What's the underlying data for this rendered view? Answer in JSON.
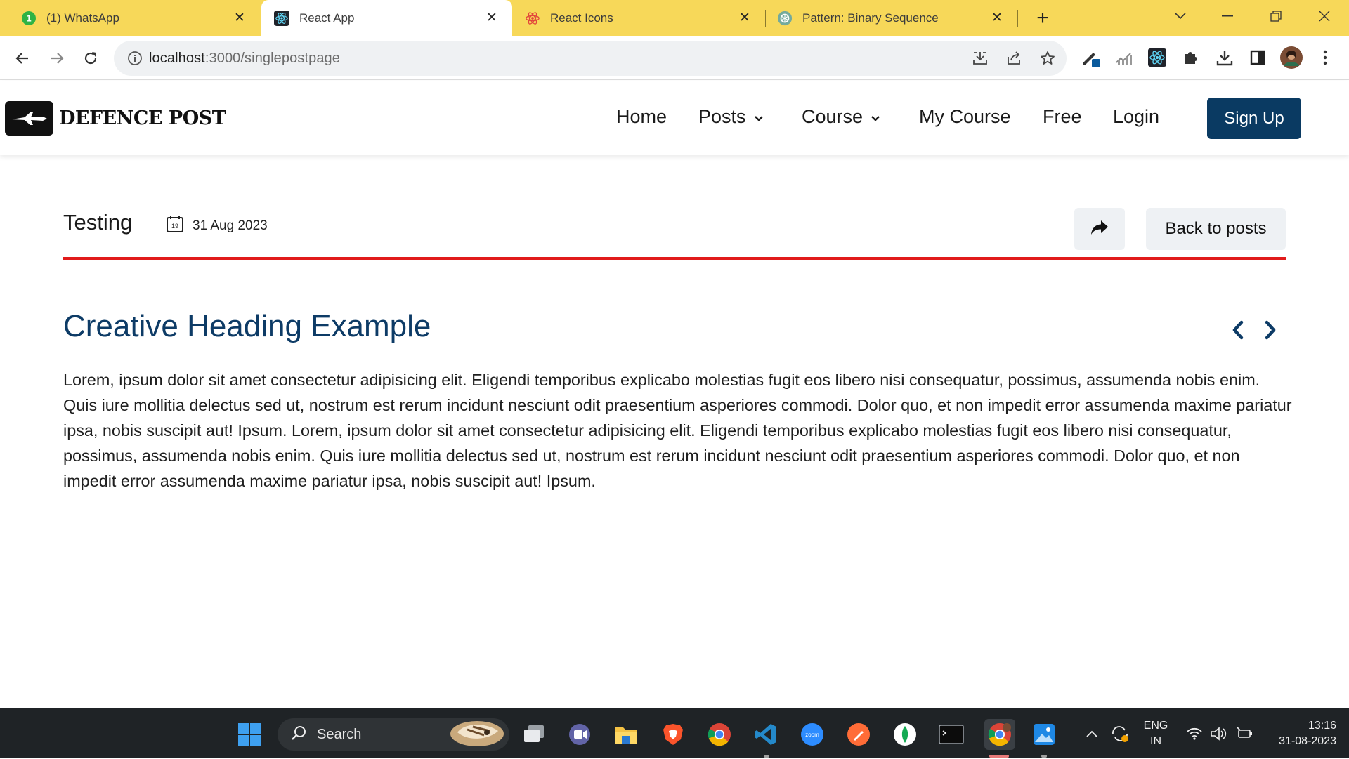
{
  "browser": {
    "tabs": [
      {
        "label": "(1) WhatsApp",
        "active": false,
        "icon": "whatsapp-icon"
      },
      {
        "label": "React App",
        "active": true,
        "icon": "react-icon"
      },
      {
        "label": "React Icons",
        "active": false,
        "icon": "react-icon"
      },
      {
        "label": "Pattern: Binary Sequence",
        "active": false,
        "icon": "chatgpt-icon"
      }
    ],
    "whatsapp_badge": "1",
    "url_host": "localhost",
    "url_path": ":3000/singlepostpage"
  },
  "site": {
    "logo_text": "DEFENCE POST",
    "nav": {
      "home": "Home",
      "posts": "Posts",
      "course": "Course",
      "my_course": "My Course",
      "free": "Free",
      "login": "Login",
      "signup": "Sign Up"
    },
    "colors": {
      "brand": "#0a3a62",
      "accent_rule": "#e11b1b",
      "heading": "#0d3b66"
    }
  },
  "post": {
    "category": "Testing",
    "calendar_day": "19",
    "date": "31 Aug 2023",
    "back_label": "Back to posts",
    "heading": "Creative Heading Example",
    "body": "Lorem, ipsum dolor sit amet consectetur adipisicing elit. Eligendi temporibus explicabo molestias fugit eos libero nisi consequatur, possimus, assumenda nobis enim. Quis iure mollitia delectus sed ut, nostrum est rerum incidunt nesciunt odit praesentium asperiores commodi. Dolor quo, et non impedit error assumenda maxime pariatur ipsa, nobis suscipit aut! Ipsum. Lorem, ipsum dolor sit amet consectetur adipisicing elit. Eligendi temporibus explicabo molestias fugit eos libero nisi consequatur, possimus, assumenda nobis enim. Quis iure mollitia delectus sed ut, nostrum est rerum incidunt nesciunt odit praesentium asperiores commodi. Dolor quo, et non impedit error assumenda maxime pariatur ipsa, nobis suscipit aut! Ipsum."
  },
  "taskbar": {
    "search_label": "Search",
    "lang_line1": "ENG",
    "lang_line2": "IN",
    "time": "13:16",
    "date": "31-08-2023"
  }
}
